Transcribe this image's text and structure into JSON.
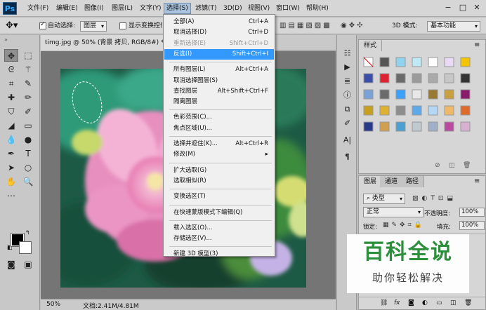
{
  "app": {
    "logo": "Ps"
  },
  "menubar": {
    "items": [
      "文件(F)",
      "编辑(E)",
      "图像(I)",
      "图层(L)",
      "文字(Y)",
      "选择(S)",
      "滤镜(T)",
      "3D(D)",
      "视图(V)",
      "窗口(W)",
      "帮助(H)"
    ],
    "active_index": 5,
    "window_controls": [
      "−",
      "□",
      "✕"
    ]
  },
  "options": {
    "auto_select_label": "自动选择:",
    "auto_select_checked": true,
    "auto_select_target": "图层",
    "show_transform_label": "显示变换控件",
    "show_transform_checked": false,
    "mode_3d_label": "3D 模式:",
    "workspace": "基本功能"
  },
  "document": {
    "tab_title": "timg.jpg @ 50% (背景 拷贝, RGB/8#) *",
    "tab_close": "×",
    "zoom": "50%",
    "doc_info": "文档:2.41M/4.81M"
  },
  "select_menu": {
    "groups": [
      [
        {
          "label": "全部(A)",
          "shortcut": "Ctrl+A",
          "state": "normal"
        },
        {
          "label": "取消选择(D)",
          "shortcut": "Ctrl+D",
          "state": "normal"
        },
        {
          "label": "重新选择(E)",
          "shortcut": "Shift+Ctrl+D",
          "state": "disabled"
        },
        {
          "label": "反选(I)",
          "shortcut": "Shift+Ctrl+I",
          "state": "highlighted"
        }
      ],
      [
        {
          "label": "所有图层(L)",
          "shortcut": "Alt+Ctrl+A",
          "state": "normal"
        },
        {
          "label": "取消选择图层(S)",
          "shortcut": "",
          "state": "normal"
        },
        {
          "label": "查找图层",
          "shortcut": "Alt+Shift+Ctrl+F",
          "state": "normal"
        },
        {
          "label": "隔离图层",
          "shortcut": "",
          "state": "normal"
        }
      ],
      [
        {
          "label": "色彩范围(C)...",
          "shortcut": "",
          "state": "normal"
        },
        {
          "label": "焦点区域(U)...",
          "shortcut": "",
          "state": "normal"
        }
      ],
      [
        {
          "label": "选择并遮住(K)...",
          "shortcut": "Alt+Ctrl+R",
          "state": "normal"
        },
        {
          "label": "修改(M)",
          "shortcut": "▸",
          "state": "normal"
        }
      ],
      [
        {
          "label": "扩大选取(G)",
          "shortcut": "",
          "state": "normal"
        },
        {
          "label": "选取相似(R)",
          "shortcut": "",
          "state": "normal"
        }
      ],
      [
        {
          "label": "变换选区(T)",
          "shortcut": "",
          "state": "normal"
        }
      ],
      [
        {
          "label": "在快速蒙版模式下编辑(Q)",
          "shortcut": "",
          "state": "normal"
        }
      ],
      [
        {
          "label": "载入选区(O)...",
          "shortcut": "",
          "state": "normal"
        },
        {
          "label": "存储选区(V)...",
          "shortcut": "",
          "state": "normal"
        }
      ],
      [
        {
          "label": "新建 3D 模型(3)",
          "shortcut": "",
          "state": "normal"
        }
      ]
    ]
  },
  "styles_panel": {
    "tab": "样式"
  },
  "layers_panel": {
    "tabs": [
      "图层",
      "通道",
      "路径"
    ],
    "filter_label": "类型",
    "blend_mode": "正常",
    "opacity_label": "不透明度:",
    "opacity_value": "100%",
    "lock_label": "锁定:",
    "fill_label": "填充:",
    "fill_value": "100%",
    "footer_fx": "fx"
  },
  "watermark": {
    "title": "百科全说",
    "subtitle": "助你轻松解决"
  },
  "colors": {
    "foreground": "#000000",
    "background": "#ffffff",
    "highlight": "#3399ff",
    "watermark_green": "#2b8f3c"
  }
}
